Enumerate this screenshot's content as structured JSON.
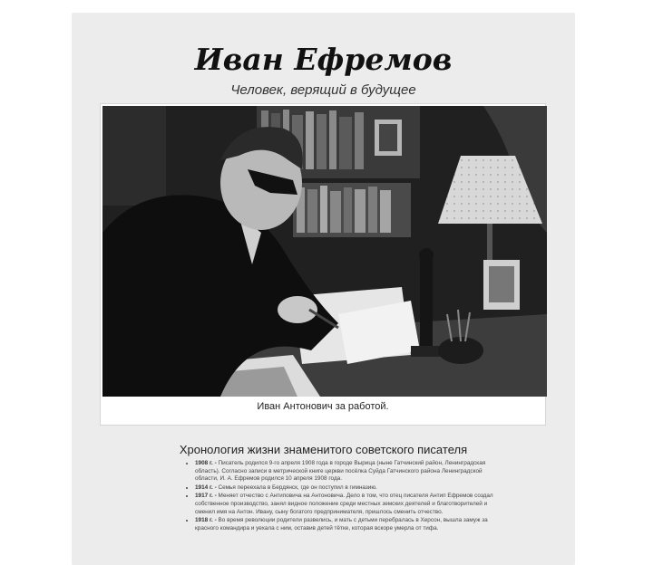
{
  "page": {
    "title": "Иван Ефремов",
    "subtitle": "Человек, верящий в будущее",
    "photo": {
      "caption": "Иван Антонович за работой."
    },
    "chronology": {
      "heading": "Хронология жизни знаменитого советского писателя",
      "items": [
        {
          "year": "1908 г. -",
          "text": "Писатель родился 9-го апреля 1908 года в городе Вырица (ныне Гатчинский район, Ленинградская область). Согласно записи в метрической книге церкви посёлка Суйда Гатчинского района Ленинградской области, И. А. Ефремов родился 10 апреля 1908 года."
        },
        {
          "year": "1914 г. -",
          "text": "Семья переехала в Бердянск, где он поступил в гимназию."
        },
        {
          "year": "1917 г. -",
          "text": "Меняет отчество с Антиповича на Антоновича. Дело в том, что отец писателя Антип Ефремов создал собственное производство, занял видное положение среди местных земских деятелей и благотворителей и сменил имя на Антон. Ивану, сыну богатого предпринимателя, пришлось сменить отчество."
        },
        {
          "year": "1918 г. -",
          "text": "Во время революции родители развелись, и мать с детьми перебралась в Херсон, вышла замуж за красного командира и уехала с ним, оставив детей тётке, которая вскоре умерла от тифа."
        }
      ]
    }
  }
}
